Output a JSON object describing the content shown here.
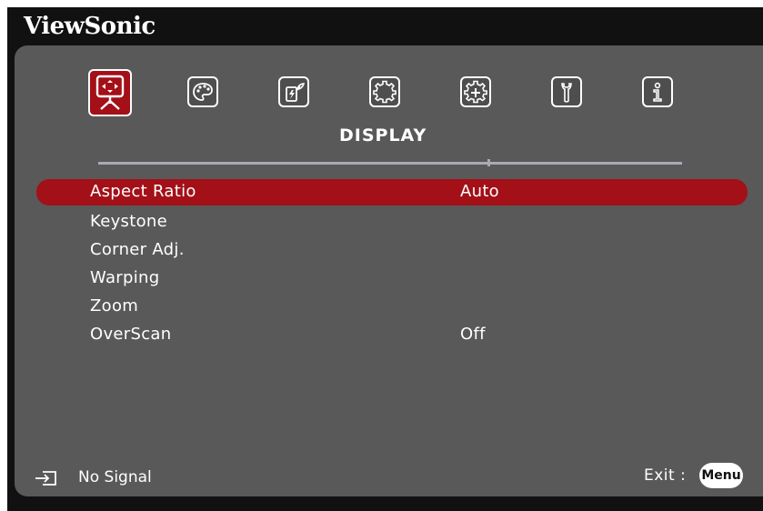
{
  "brand": "ViewSonic",
  "tabs": [
    {
      "name": "display",
      "icon": "display-icon",
      "active": true
    },
    {
      "name": "image",
      "icon": "palette-icon",
      "active": false
    },
    {
      "name": "power",
      "icon": "power-management-icon",
      "active": false
    },
    {
      "name": "basic",
      "icon": "gear-icon",
      "active": false
    },
    {
      "name": "advanced",
      "icon": "advanced-gear-icon",
      "active": false
    },
    {
      "name": "system",
      "icon": "wrench-icon",
      "active": false
    },
    {
      "name": "information",
      "icon": "info-icon",
      "active": false
    }
  ],
  "tab_title": "DISPLAY",
  "menu": {
    "items": [
      {
        "label": "Aspect Ratio",
        "value": "Auto",
        "selected": true
      },
      {
        "label": "Keystone",
        "value": ""
      },
      {
        "label": "Corner Adj.",
        "value": ""
      },
      {
        "label": "Warping",
        "value": ""
      },
      {
        "label": "Zoom",
        "value": ""
      },
      {
        "label": "OverScan",
        "value": "Off"
      }
    ]
  },
  "status": {
    "source_icon": "input-source-icon",
    "text": "No Signal"
  },
  "footer": {
    "exit_label": "Exit :",
    "menu_button": "Menu"
  },
  "colors": {
    "accent": "#a31018",
    "panel": "#595959",
    "background": "#111111",
    "divider": "#aaaab4"
  }
}
